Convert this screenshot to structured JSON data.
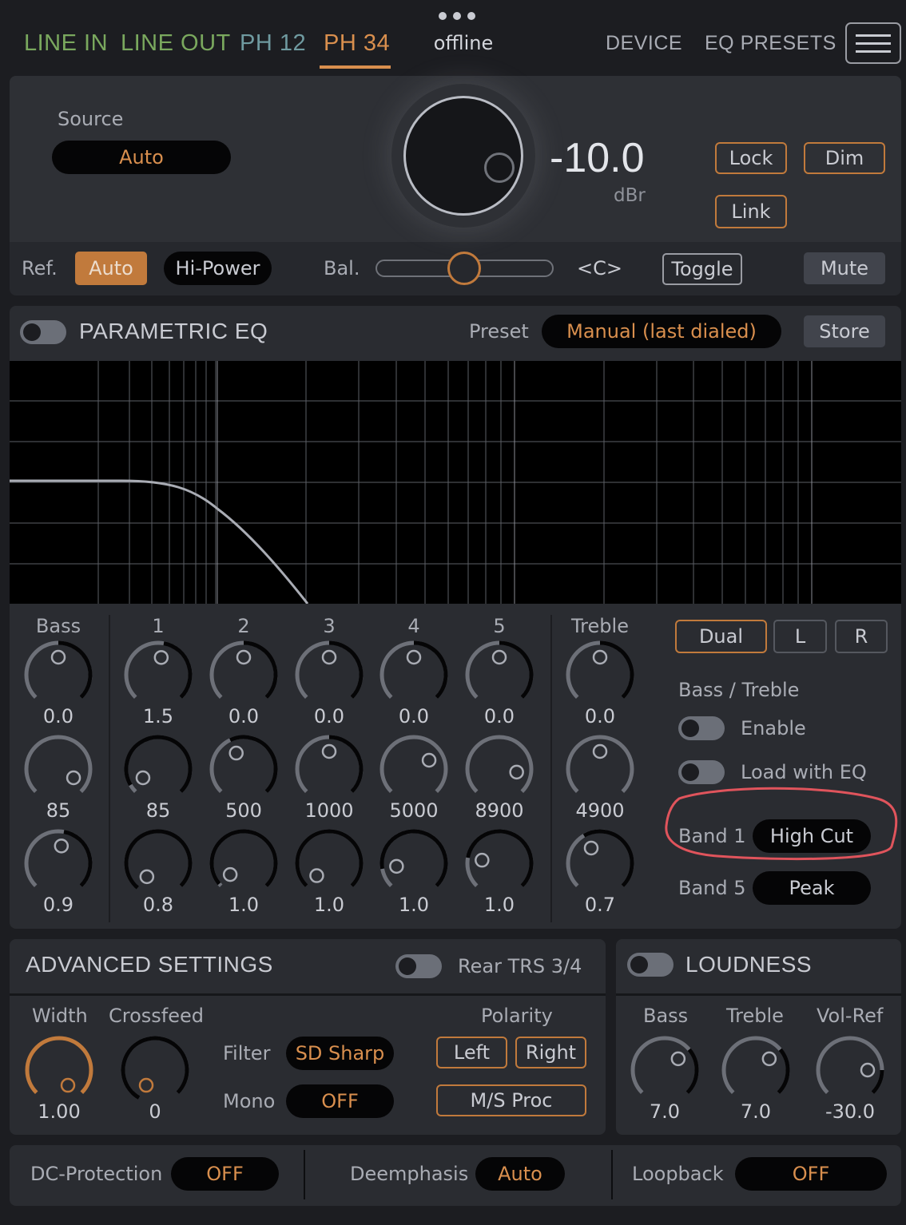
{
  "colors": {
    "accent": "#d98f4e",
    "green": "#7aa85e",
    "teal": "#6f9aa0",
    "bg": "#1c1d21",
    "panel": "#2a2c31",
    "annotation": "#e0545c"
  },
  "top_tabs": [
    {
      "label": "LINE IN",
      "color": "#7aa85e"
    },
    {
      "label": "LINE OUT",
      "color": "#7aa85e"
    },
    {
      "label": "PH 12",
      "color": "#6f9aa0"
    },
    {
      "label": "PH 34",
      "color": "#d98f4e",
      "active": true
    }
  ],
  "status": "offline",
  "more_icon": "ellipsis-icon",
  "nav": {
    "device": "DEVICE",
    "eq_presets": "EQ PRESETS",
    "menu_icon": "hamburger-menu-icon"
  },
  "volume": {
    "source_label": "Source",
    "source_value": "Auto",
    "value": "-10.0",
    "unit": "dBr",
    "lock": "Lock",
    "dim": "Dim",
    "link": "Link"
  },
  "ref_row": {
    "ref_label": "Ref.",
    "ref_auto": "Auto",
    "hi_power": "Hi-Power",
    "bal_label": "Bal.",
    "balance_position": 0.5,
    "bal_value": "<C>",
    "toggle": "Toggle",
    "mute": "Mute"
  },
  "peq": {
    "title": "PARAMETRIC EQ",
    "preset_label": "Preset",
    "preset_value": "Manual (last dialed)",
    "store": "Store"
  },
  "eq_bands": [
    {
      "name": "Bass",
      "gain": "0.0",
      "freq": "85",
      "q": "0.9"
    },
    {
      "name": "1",
      "gain": "1.5",
      "freq": "85",
      "q": "0.8"
    },
    {
      "name": "2",
      "gain": "0.0",
      "freq": "500",
      "q": "1.0"
    },
    {
      "name": "3",
      "gain": "0.0",
      "freq": "1000",
      "q": "1.0"
    },
    {
      "name": "4",
      "gain": "0.0",
      "freq": "5000",
      "q": "1.0"
    },
    {
      "name": "5",
      "gain": "0.0",
      "freq": "8900",
      "q": "1.0"
    },
    {
      "name": "Treble",
      "gain": "0.0",
      "freq": "4900",
      "q": "0.7"
    }
  ],
  "eq_side": {
    "dual": "Dual",
    "l": "L",
    "r": "R",
    "bass_treble": "Bass / Treble",
    "enable": "Enable",
    "load_with_eq": "Load with EQ",
    "band1_label": "Band 1",
    "band1_value": "High Cut",
    "band5_label": "Band 5",
    "band5_value": "Peak"
  },
  "advanced": {
    "title": "ADVANCED SETTINGS",
    "rear_trs": "Rear TRS 3/4",
    "width_label": "Width",
    "width_value": "1.00",
    "crossfeed_label": "Crossfeed",
    "crossfeed_value": "0",
    "filter_label": "Filter",
    "filter_value": "SD Sharp",
    "mono_label": "Mono",
    "mono_value": "OFF",
    "polarity_label": "Polarity",
    "left": "Left",
    "right": "Right",
    "ms_proc": "M/S Proc"
  },
  "loudness": {
    "title": "LOUDNESS",
    "bass_label": "Bass",
    "bass_value": "7.0",
    "treble_label": "Treble",
    "treble_value": "7.0",
    "volref_label": "Vol-Ref",
    "volref_value": "-30.0"
  },
  "footer": {
    "dc_label": "DC-Protection",
    "dc_value": "OFF",
    "deemph_label": "Deemphasis",
    "deemph_value": "Auto",
    "loopback_label": "Loopback",
    "loopback_value": "OFF"
  }
}
